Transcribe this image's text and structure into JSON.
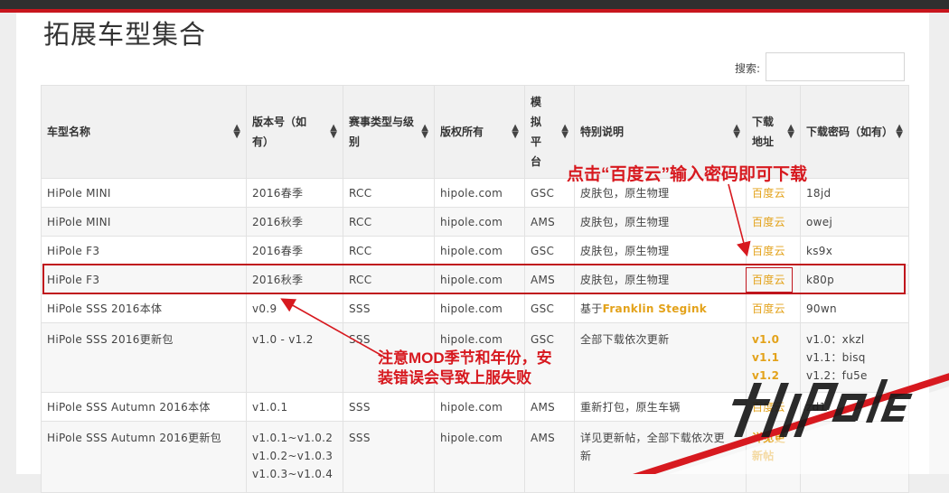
{
  "page": {
    "title": "拓展车型集合"
  },
  "search": {
    "label": "搜索:"
  },
  "table": {
    "headers": [
      "车型名称",
      "版本号（如有）",
      "赛事类型与级别",
      "版权所有",
      "模拟平台",
      "特别说明",
      "下载地址",
      "下载密码（如有）"
    ],
    "rows": [
      {
        "name": "HiPole MINI",
        "version": "2016春季",
        "series": "RCC",
        "copyright": "hipole.com",
        "platform": "GSC",
        "notes": "皮肤包，原生物理",
        "download": "百度云",
        "password": "18jd"
      },
      {
        "name": "HiPole MINI",
        "version": "2016秋季",
        "series": "RCC",
        "copyright": "hipole.com",
        "platform": "AMS",
        "notes": "皮肤包，原生物理",
        "download": "百度云",
        "password": "owej"
      },
      {
        "name": "HiPole F3",
        "version": "2016春季",
        "series": "RCC",
        "copyright": "hipole.com",
        "platform": "GSC",
        "notes": "皮肤包，原生物理",
        "download": "百度云",
        "password": "ks9x"
      },
      {
        "name": "HiPole F3",
        "version": "2016秋季",
        "series": "RCC",
        "copyright": "hipole.com",
        "platform": "AMS",
        "notes": "皮肤包，原生物理",
        "download": "百度云",
        "password": "k80p"
      },
      {
        "name": "HiPole SSS 2016本体",
        "version": "v0.9",
        "series": "SSS",
        "copyright": "hipole.com",
        "platform": "GSC",
        "notes_prefix": "基于",
        "notes_link": "Franklin Stegink",
        "download": "百度云",
        "password": "90wn"
      },
      {
        "name": "HiPole SSS 2016更新包",
        "version": "v1.0 - v1.2",
        "series": "SSS",
        "copyright": "hipole.com",
        "platform": "GSC",
        "notes": "全部下载依次更新",
        "download_lines": [
          "v1.0",
          "v1.1",
          "v1.2"
        ],
        "password_lines": [
          "v1.0：xkzl",
          "v1.1：bisq",
          "v1.2：fu5e"
        ]
      },
      {
        "name": "HiPole SSS Autumn 2016本体",
        "version": "v1.0.1",
        "series": "SSS",
        "copyright": "hipole.com",
        "platform": "AMS",
        "notes": "重新打包，原生车辆",
        "download": "百度云",
        "password": "zd1"
      },
      {
        "name": "HiPole SSS Autumn 2016更新包",
        "version_lines": [
          "v1.0.1~v1.0.2",
          "v1.0.2~v1.0.3",
          "v1.0.3~v1.0.4"
        ],
        "series": "SSS",
        "copyright": "hipole.com",
        "platform": "AMS",
        "notes_lines": [
          "详见更新帖，全部下载依次更",
          "新"
        ],
        "download": "详见更新帖"
      }
    ]
  },
  "annotations": {
    "note1": "点击“百度云”输入密码即可下载",
    "note2_line1": "注意MOD季节和年份，安",
    "note2_line2": "装错误会导致上服失败",
    "color": "#d7191f"
  },
  "watermark": {
    "text": "HiPole"
  }
}
